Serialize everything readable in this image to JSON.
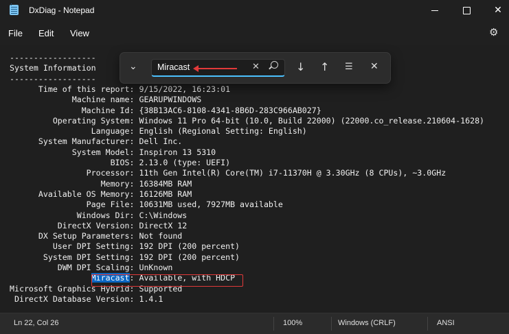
{
  "window": {
    "title": "DxDiag - Notepad"
  },
  "window_controls": {
    "minimize": "—",
    "maximize": "",
    "close": "✕"
  },
  "menu": {
    "file": "File",
    "edit": "Edit",
    "view": "View"
  },
  "find": {
    "value": "Miracast"
  },
  "content": {
    "lines": [
      "------------------",
      "System Information",
      "------------------",
      "      Time of this report: 9/15/2022, 16:23:01",
      "             Machine name: GEARUPWINDOWS",
      "               Machine Id: {38B13AC6-8108-4341-8B6D-283C966AB027}",
      "         Operating System: Windows 11 Pro 64-bit (10.0, Build 22000) (22000.co_release.210604-1628)",
      "                 Language: English (Regional Setting: English)",
      "      System Manufacturer: Dell Inc.",
      "             System Model: Inspiron 13 5310",
      "                     BIOS: 2.13.0 (type: UEFI)",
      "                Processor: 11th Gen Intel(R) Core(TM) i7-11370H @ 3.30GHz (8 CPUs), ~3.0GHz",
      "                   Memory: 16384MB RAM",
      "      Available OS Memory: 16126MB RAM",
      "                Page File: 10631MB used, 7927MB available",
      "              Windows Dir: C:\\Windows",
      "          DirectX Version: DirectX 12",
      "      DX Setup Parameters: Not found",
      "         User DPI Setting: 192 DPI (200 percent)",
      "       System DPI Setting: 192 DPI (200 percent)",
      "          DWM DPI Scaling: UnKnown"
    ],
    "miracast_prefix": "                 ",
    "miracast_match": "Miracast",
    "miracast_rest": ": Available, with HDCP",
    "after_lines": [
      "Microsoft Graphics Hybrid: Supported",
      " DirectX Database Version: 1.4.1"
    ]
  },
  "status": {
    "position": "Ln 22, Col 26",
    "zoom": "100%",
    "line_ending": "Windows (CRLF)",
    "encoding": "ANSI"
  },
  "colors": {
    "highlight": "#0a66c2",
    "annotation": "#e23a3a",
    "accent": "#4cc2ff"
  }
}
